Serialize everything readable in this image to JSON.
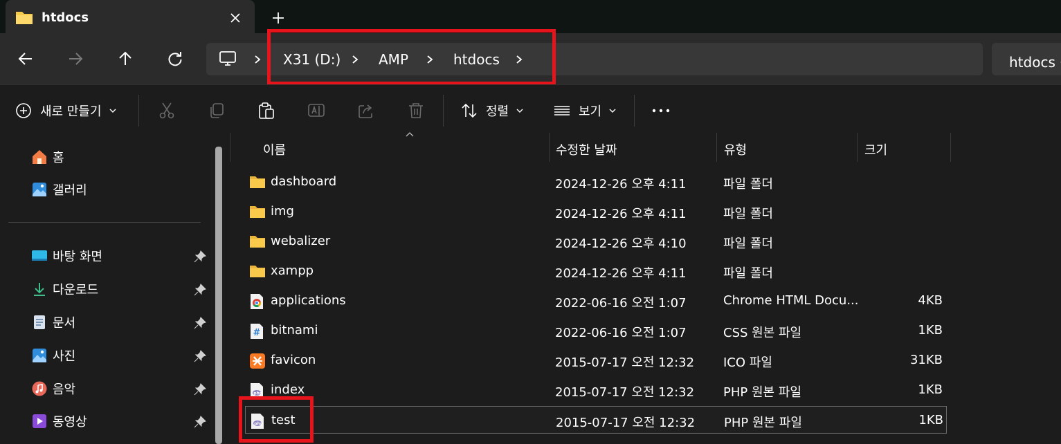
{
  "window": {
    "tab_title": "htdocs"
  },
  "colors": {
    "accent_red": "#e8141b",
    "folder_yellow": "#f8c94a",
    "background": "#1c1c1c"
  },
  "address_bar": {
    "crumbs": [
      "X31 (D:)",
      "AMP",
      "htdocs"
    ],
    "search_text": "htdocs 검색"
  },
  "toolbar": {
    "new_label": "새로 만들기",
    "sort_label": "정렬",
    "view_label": "보기"
  },
  "sidebar": {
    "top_items": [
      {
        "label": "홈",
        "icon": "home-icon"
      },
      {
        "label": "갤러리",
        "icon": "gallery-icon"
      }
    ],
    "pinned_items": [
      {
        "label": "바탕 화면",
        "icon": "desktop-icon"
      },
      {
        "label": "다운로드",
        "icon": "download-icon"
      },
      {
        "label": "문서",
        "icon": "document-icon"
      },
      {
        "label": "사진",
        "icon": "picture-icon"
      },
      {
        "label": "음악",
        "icon": "music-icon"
      },
      {
        "label": "동영상",
        "icon": "video-icon"
      }
    ]
  },
  "columns": {
    "name": "이름",
    "date": "수정한 날짜",
    "type": "유형",
    "size": "크기"
  },
  "files": [
    {
      "name": "dashboard",
      "date": "2024-12-26 오후 4:11",
      "type": "파일 폴더",
      "size": "",
      "icon": "folder-icon"
    },
    {
      "name": "img",
      "date": "2024-12-26 오후 4:11",
      "type": "파일 폴더",
      "size": "",
      "icon": "folder-icon"
    },
    {
      "name": "webalizer",
      "date": "2024-12-26 오후 4:10",
      "type": "파일 폴더",
      "size": "",
      "icon": "folder-icon"
    },
    {
      "name": "xampp",
      "date": "2024-12-26 오후 4:11",
      "type": "파일 폴더",
      "size": "",
      "icon": "folder-icon"
    },
    {
      "name": "applications",
      "date": "2022-06-16 오전 1:07",
      "type": "Chrome HTML Docu...",
      "size": "4KB",
      "icon": "chrome-html-icon"
    },
    {
      "name": "bitnami",
      "date": "2022-06-16 오전 1:07",
      "type": "CSS 원본 파일",
      "size": "1KB",
      "icon": "css-file-icon"
    },
    {
      "name": "favicon",
      "date": "2015-07-17 오전 12:32",
      "type": "ICO 파일",
      "size": "31KB",
      "icon": "xampp-ico-icon"
    },
    {
      "name": "index",
      "date": "2015-07-17 오전 12:32",
      "type": "PHP 원본 파일",
      "size": "1KB",
      "icon": "php-file-icon"
    },
    {
      "name": "test",
      "date": "2015-07-17 오전 12:32",
      "type": "PHP 원본 파일",
      "size": "1KB",
      "icon": "php-file-icon",
      "selected": true
    }
  ]
}
